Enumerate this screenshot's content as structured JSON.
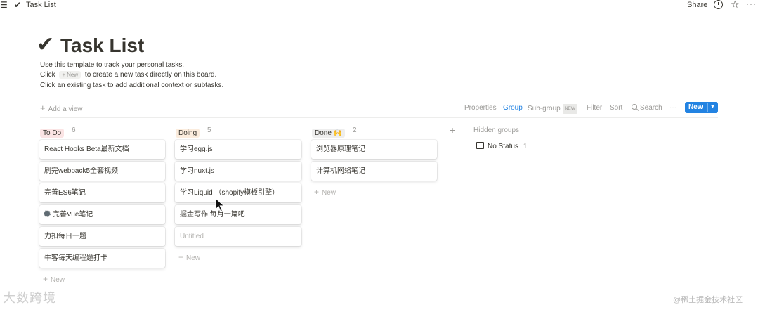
{
  "topbar": {
    "title": "Task List",
    "share_label": "Share"
  },
  "icons": {
    "menu": "menu-icon",
    "page": "checkmark-icon",
    "history": "clock-icon",
    "favorite": "star-icon",
    "more": "more-icon",
    "search": "search-icon",
    "inbox": "inbox-icon"
  },
  "colors": {
    "accent": "#2383e2",
    "todo_tag_bg": "#fbe4e4",
    "doing_tag_bg": "#fbecdd",
    "done_tag_bg": "#eeeeee"
  },
  "page": {
    "check": "✔",
    "title": "Task List",
    "desc1": "Use this template to track your personal tasks.",
    "desc2_pre": "Click",
    "desc2_badge": "New",
    "desc2_post": "to create a new task directly on this board.",
    "desc3": "Click an existing task to add additional context or subtasks."
  },
  "viewbar": {
    "add_view": "Add a view",
    "properties": "Properties",
    "group": "Group",
    "subgroup": "Sub-group",
    "subgroup_badge": "NEW",
    "filter": "Filter",
    "sort": "Sort",
    "search": "Search",
    "more": "···",
    "new_button": "New"
  },
  "columns": [
    {
      "name": "To Do",
      "count": "6",
      "cards": [
        "React Hooks Beta最新文档",
        "刷完webpack5全套视频",
        "完善ES6笔记",
        "完善Vue笔记",
        "力扣每日一题",
        "牛客每天编程题打卡"
      ],
      "new_label": "New"
    },
    {
      "name": "Doing",
      "count": "5",
      "cards": [
        "学习egg.js",
        "学习nuxt.js",
        "学习Liquid （shopify模板引擎）",
        "掘金写作  每月一篇吧",
        "Untitled"
      ],
      "new_label": "New"
    },
    {
      "name": "Done 🙌",
      "count": "2",
      "cards": [
        "浏览器原理笔记",
        "计算机网络笔记"
      ],
      "new_label": "New"
    }
  ],
  "hidden": {
    "label": "Hidden groups",
    "no_status": "No Status",
    "no_status_count": "1"
  },
  "watermark": {
    "left": "大数跨境",
    "right": "@稀土掘金技术社区"
  }
}
